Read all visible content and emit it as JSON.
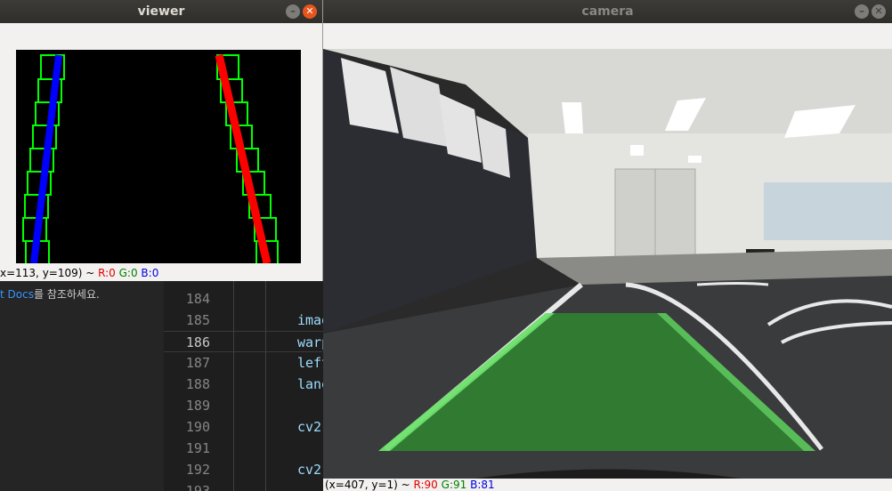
{
  "editor": {
    "sidebar_link": "t Docs",
    "sidebar_text": "를 참조하세요.",
    "lines": [
      {
        "num": "184",
        "code": ""
      },
      {
        "num": "185",
        "code": "imag"
      },
      {
        "num": "186",
        "code": "warp"
      },
      {
        "num": "187",
        "code": "left"
      },
      {
        "num": "188",
        "code": "lane"
      },
      {
        "num": "189",
        "code": ""
      },
      {
        "num": "190",
        "code": "cv2"
      },
      {
        "num": "191",
        "code": ""
      },
      {
        "num": "192",
        "code": "cv2"
      },
      {
        "num": "193",
        "code": ""
      }
    ]
  },
  "viewer": {
    "title": "viewer",
    "status": {
      "coords": "x=113, y=109) ~ ",
      "r": "R:0",
      "g": "G:0",
      "b": "B:0"
    }
  },
  "camera": {
    "title": "camera",
    "status": {
      "coords": "(x=407, y=1) ~ ",
      "r": "R:90",
      "g": "G:91",
      "b": "B:81"
    }
  },
  "colors": {
    "left_lane": "#0000ff",
    "right_lane": "#ff0000",
    "sliding_window": "#00ff00",
    "lane_overlay": "#2e8b2e",
    "close_button": "#e9541d"
  },
  "icons": {
    "minimize": "minimize-icon",
    "close": "close-icon"
  }
}
